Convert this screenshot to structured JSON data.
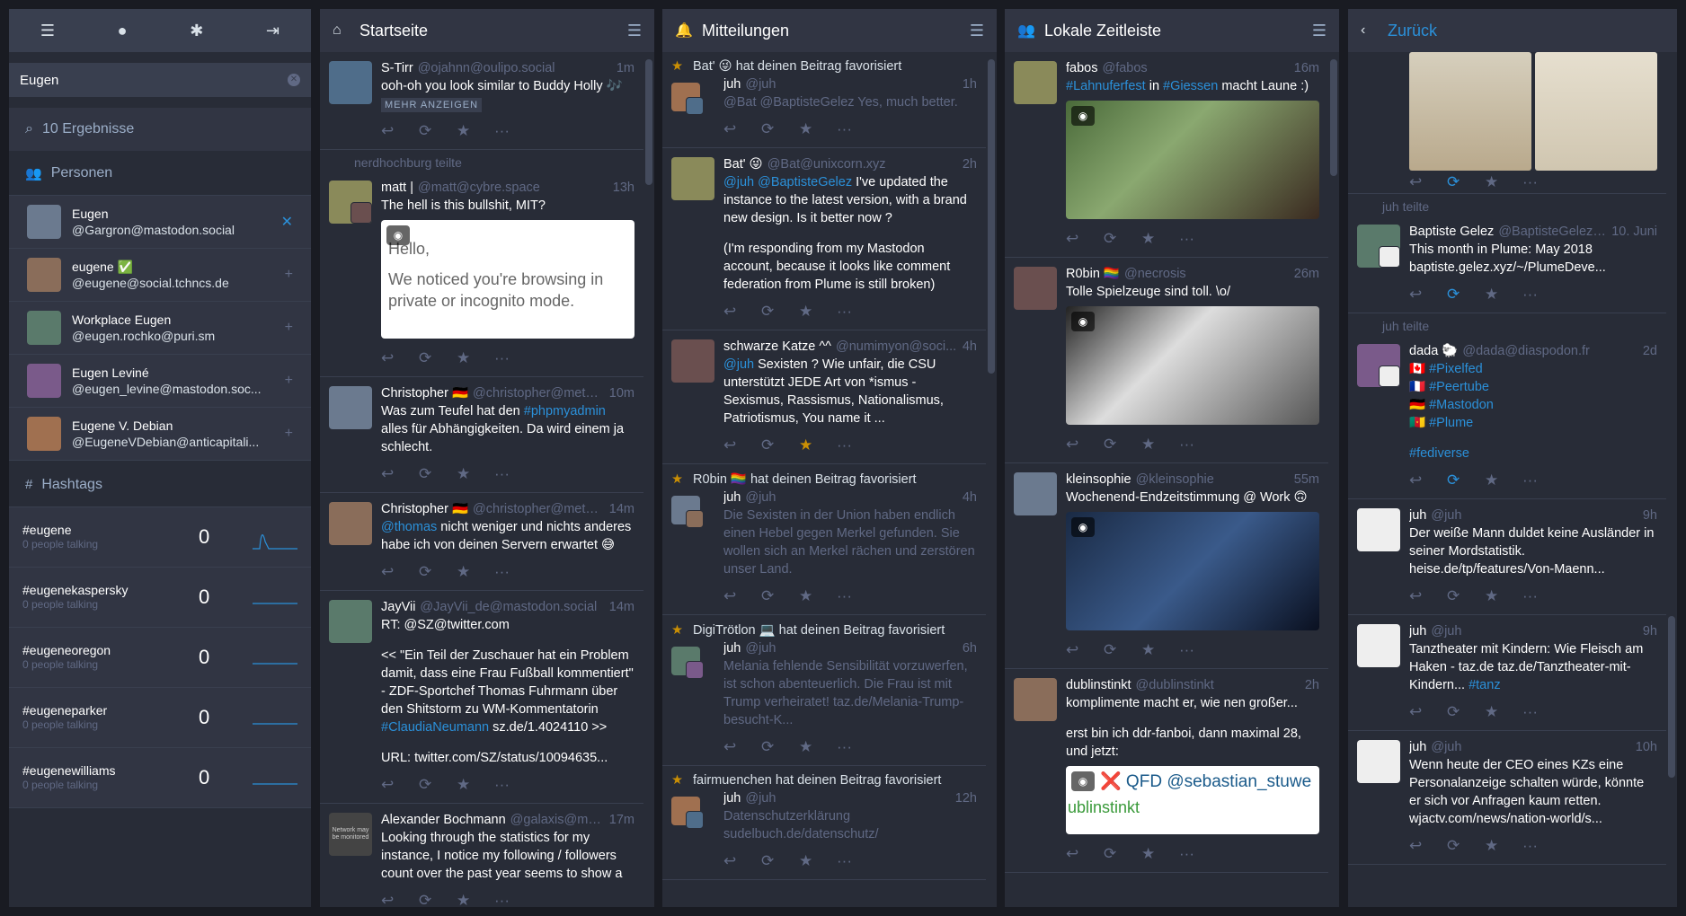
{
  "sidebar": {
    "search_value": "Eugen",
    "results_label": "10 Ergebnisse",
    "people_label": "Personen",
    "hashtags_label": "Hashtags",
    "accounts": [
      {
        "name": "Eugen",
        "handle": "@Gargron@mastodon.social",
        "following": true
      },
      {
        "name": "eugene ✅",
        "handle": "@eugene@social.tchncs.de",
        "following": false
      },
      {
        "name": "Workplace Eugen",
        "handle": "@eugen.rochko@puri.sm",
        "following": false
      },
      {
        "name": "Eugen Leviné",
        "handle": "@eugen_levine@mastodon.soc...",
        "following": false
      },
      {
        "name": "Eugene V. Debian",
        "handle": "@EugeneVDebian@anticapitali...",
        "following": false
      }
    ],
    "hashtags": [
      {
        "tag": "#eugene",
        "people": "0 people talking",
        "count": "0"
      },
      {
        "tag": "#eugenekaspersky",
        "people": "0 people talking",
        "count": "0"
      },
      {
        "tag": "#eugeneoregon",
        "people": "0 people talking",
        "count": "0"
      },
      {
        "tag": "#eugeneparker",
        "people": "0 people talking",
        "count": "0"
      },
      {
        "tag": "#eugenewilliams",
        "people": "0 people talking",
        "count": "0"
      }
    ]
  },
  "home": {
    "title": "Startseite",
    "statuses": [
      {
        "name": "S-Tirr",
        "acct": "@ojahnn@oulipo.social",
        "time": "1m",
        "text": "ooh-oh you look similar to Buddy Holly 🎶",
        "more": "MEHR ANZEIGEN"
      },
      {
        "boost": "nerdhochburg teilte",
        "name": "matt |",
        "acct": "@matt@cybre.space",
        "time": "13h",
        "text": "The hell is this bullshit, MIT?",
        "card1": "Hello,",
        "card2": "We noticed you're browsing in private or incognito mode."
      },
      {
        "name": "Christopher 🇩🇪",
        "acct": "@christopher@metalh...",
        "time": "10m",
        "pre": "Was zum Teufel hat den ",
        "tag": "#phpmyadmin",
        "post": " alles für Abhängigkeiten. Da wird einem ja schlecht."
      },
      {
        "name": "Christopher 🇩🇪",
        "acct": "@christopher@metalh...",
        "time": "14m",
        "mention": "@thomas",
        "post": " nicht weniger und nichts anderes habe ich von deinen Servern erwartet 😅"
      },
      {
        "name": "JayVii",
        "acct": "@JayVii_de@mastodon.social",
        "time": "14m",
        "l1": "RT: @SZ@twitter.com",
        "l2": "<< \"Ein Teil der Zuschauer hat ein Problem damit, dass eine Frau Fußball kommentiert\" - ZDF-Sportchef Thomas Fuhrmann über den Shitstorm zu WM-Kommentatorin ",
        "tag": "#ClaudiaNeumann",
        "l2b": " sz.de/1.4024110 >>",
        "l3": "URL: twitter.com/SZ/status/10094635..."
      },
      {
        "name": "Alexander Bochmann",
        "acct": "@galaxis@mast...",
        "time": "17m",
        "text": "Looking through the statistics for my instance, I notice my following / followers count over the past year seems to show a",
        "warn": "Network may be monitored"
      }
    ]
  },
  "notifications": {
    "title": "Mitteilungen",
    "items": [
      {
        "notice": "Bat' 😜 hat deinen Beitrag favorisiert",
        "name": "juh",
        "acct": "@juh",
        "time": "1h",
        "text": "@Bat @BaptisteGelez Yes, much better."
      },
      {
        "name": "Bat' 😜",
        "acct": "@Bat@unixcorn.xyz",
        "time": "2h",
        "mention": "@juh @BaptisteGelez",
        "text": " I've updated the instance to the latest version, with a brand new design. Is it better now ?",
        "text2": "(I'm responding from my Mastodon account, because it looks like comment federation from Plume is still broken)"
      },
      {
        "name": "schwarze Katze ^^",
        "acct": "@numimyon@soci...",
        "time": "4h",
        "mention": "@juh",
        "text": " Sexisten ? Wie unfair, die CSU unterstützt JEDE Art von *ismus - Sexismus, Rassismus, Nationalismus, Patriotismus, You name it ..."
      },
      {
        "notice": "R0bin 🏳️‍🌈 hat deinen Beitrag favorisiert",
        "name": "juh",
        "acct": "@juh",
        "time": "4h",
        "text": "Die Sexisten in der Union haben endlich einen Hebel gegen Merkel gefunden. Sie wollen sich an Merkel rächen und zerstören unser Land."
      },
      {
        "notice": "DigiTrötlon 💻 hat deinen Beitrag favorisiert",
        "name": "juh",
        "acct": "@juh",
        "time": "6h",
        "text": "Melania fehlende Sensibilität vorzuwerfen, ist schon abenteuerlich. Die Frau ist mit Trump verheiratet! taz.de/Melania-Trump-besucht-K..."
      },
      {
        "notice": "fairmuenchen hat deinen Beitrag favorisiert",
        "name": "juh",
        "acct": "@juh",
        "time": "12h",
        "text": "Datenschutzerklärung sudelbuch.de/datenschutz/"
      }
    ]
  },
  "local": {
    "title": "Lokale Zeitleiste",
    "statuses": [
      {
        "name": "fabos",
        "acct": "@fabos",
        "time": "16m",
        "tag1": "#Lahnuferfest",
        "mid": " in ",
        "tag2": "#Giessen",
        "post": " macht Laune :)"
      },
      {
        "name": "R0bin 🏳️‍🌈",
        "acct": "@necrosis",
        "time": "26m",
        "text": "Tolle Spielzeuge sind toll. \\o/"
      },
      {
        "name": "kleinsophie",
        "acct": "@kleinsophie",
        "time": "55m",
        "text": "Wochenend-Endzeitstimmung @ Work 🙃"
      },
      {
        "name": "dublinstinkt",
        "acct": "@dublinstinkt",
        "time": "2h",
        "text": "komplimente macht er, wie nen großer...",
        "text2": "erst bin ich ddr-fanboi, dann maximal 28, und jetzt:",
        "card": "❌ QFD @sebastian_stuwe",
        "card2": "ublinstinkt"
      }
    ]
  },
  "profile": {
    "back": "Zurück",
    "statuses": [
      {
        "boost": "juh teilte",
        "name": "Baptiste Gelez",
        "acct": "@BaptisteGelez@...",
        "time": "10. Juni",
        "text": "This month in Plume: May 2018",
        "text2": "baptiste.gelez.xyz/~/PlumeDeve..."
      },
      {
        "boost": "juh teilte",
        "name": "dada 🐑",
        "acct": "@dada@diaspodon.fr",
        "time": "2d",
        "tags": [
          "🇨🇦 #Pixelfed",
          "🇫🇷 #Peertube",
          "🇩🇪 #Mastodon",
          "🇨🇲 #Plume"
        ],
        "last": "#fediverse"
      },
      {
        "name": "juh",
        "acct": "@juh",
        "time": "9h",
        "text": "Der weiße Mann duldet keine Ausländer in seiner Mordstatistik.  heise.de/tp/features/Von-Maenn..."
      },
      {
        "name": "juh",
        "acct": "@juh",
        "time": "9h",
        "text": "Tanztheater mit Kindern: Wie Fleisch am Haken - taz.de taz.de/Tanztheater-mit-Kindern... ",
        "tag": "#tanz"
      },
      {
        "name": "juh",
        "acct": "@juh",
        "time": "10h",
        "text": "Wenn heute der CEO eines KZs eine Personalanzeige schalten würde, könnte er sich vor Anfragen kaum retten. wjactv.com/news/nation-world/s..."
      }
    ]
  }
}
